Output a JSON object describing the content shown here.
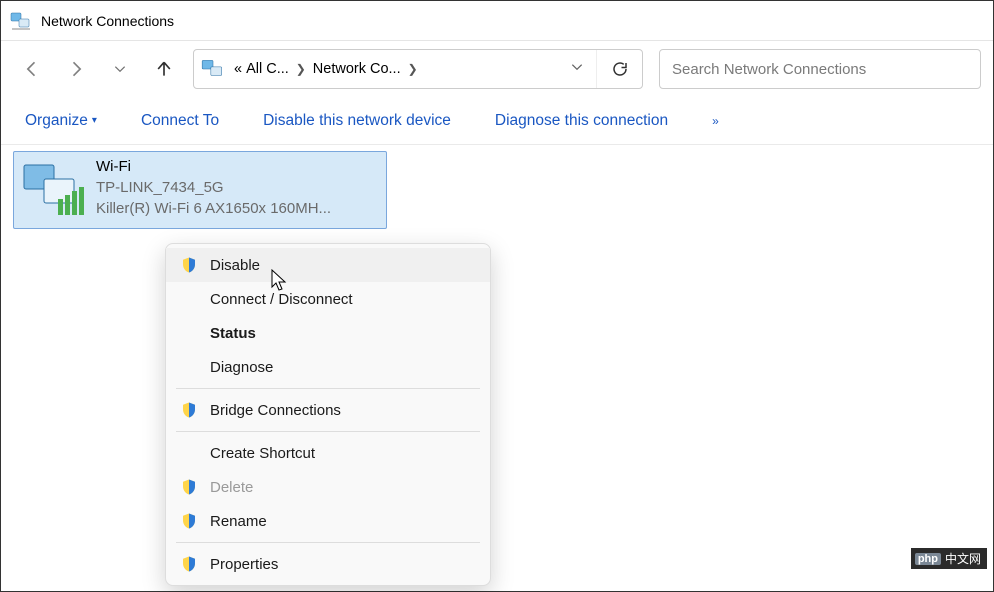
{
  "titlebar": {
    "title": "Network Connections"
  },
  "breadcrumb": {
    "overflow": "«",
    "seg1": "All C...",
    "seg2": "Network Co..."
  },
  "search": {
    "placeholder": "Search Network Connections"
  },
  "toolbar": {
    "organize": "Organize",
    "connect": "Connect To",
    "disable": "Disable this network device",
    "diagnose": "Diagnose this connection"
  },
  "adapter": {
    "name": "Wi-Fi",
    "ssid": "TP-LINK_7434_5G",
    "device": "Killer(R) Wi-Fi 6 AX1650x 160MH..."
  },
  "context_menu": {
    "items": [
      {
        "label": "Disable",
        "shield": true,
        "hover": true
      },
      {
        "label": "Connect / Disconnect"
      },
      {
        "label": "Status",
        "bold": true
      },
      {
        "label": "Diagnose"
      },
      {
        "sep": true
      },
      {
        "label": "Bridge Connections",
        "shield": true
      },
      {
        "sep": true
      },
      {
        "label": "Create Shortcut"
      },
      {
        "label": "Delete",
        "shield": true,
        "disabled": true
      },
      {
        "label": "Rename",
        "shield": true
      },
      {
        "sep": true
      },
      {
        "label": "Properties",
        "shield": true
      }
    ]
  },
  "watermark": {
    "brand": "php",
    "suffix": "中文网"
  }
}
